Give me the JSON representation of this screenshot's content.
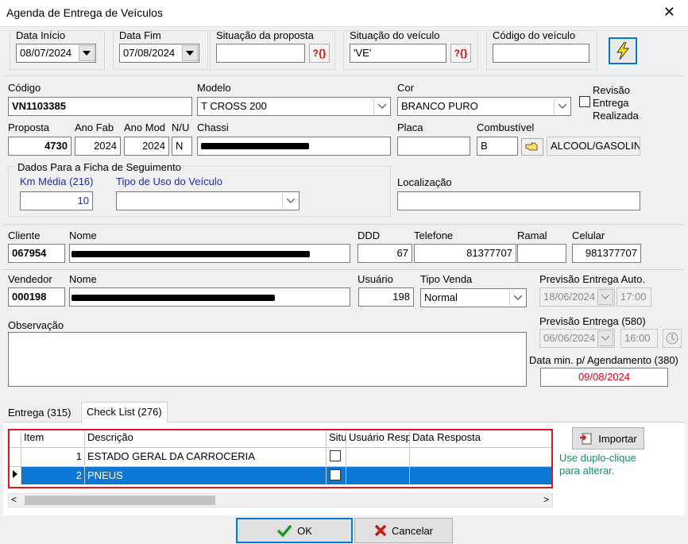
{
  "window": {
    "title": "Agenda de Entrega de Veículos",
    "close": "✕"
  },
  "filters": {
    "data_inicio_label": "Data Início",
    "data_inicio": "08/07/2024",
    "data_fim_label": "Data Fim",
    "data_fim": "07/08/2024",
    "situacao_proposta_label": "Situação da proposta",
    "situacao_proposta": "",
    "situacao_veiculo_label": "Situação do veículo",
    "situacao_veiculo": "'VE'",
    "codigo_veiculo_label": "Código do veículo",
    "codigo_veiculo": "",
    "query_button": "?{}"
  },
  "vehicle": {
    "codigo_label": "Código",
    "codigo": "VN1103385",
    "modelo_label": "Modelo",
    "modelo": "T CROSS 200",
    "cor_label": "Cor",
    "cor": "BRANCO PURO",
    "revisao_label": "Revisão Entrega Realizada",
    "revisao_line1": "Revisão",
    "revisao_line2": "Entrega",
    "revisao_line3": "Realizada",
    "proposta_label": "Proposta",
    "proposta": "4730",
    "ano_fab_label": "Ano Fab",
    "ano_fab": "2024",
    "ano_mod_label": "Ano Mod",
    "ano_mod": "2024",
    "nu_label": "N/U",
    "nu": "N",
    "chassi_label": "Chassi",
    "placa_label": "Placa",
    "placa": "",
    "combustivel_label": "Combustível",
    "combustivel_code": "B",
    "combustivel": "ALCOOL/GASOLINA"
  },
  "ficha": {
    "group_label": "Dados Para a Ficha de Seguimento",
    "km_media_label": "Km Média (216)",
    "km_media": "10",
    "tipo_uso_label": "Tipo de Uso do Veículo",
    "tipo_uso": "",
    "localizacao_label": "Localização",
    "localizacao": ""
  },
  "cliente": {
    "cliente_label": "Cliente",
    "cliente": "067954",
    "nome_label": "Nome",
    "ddd_label": "DDD",
    "ddd": "67",
    "telefone_label": "Telefone",
    "telefone": "81377707",
    "ramal_label": "Ramal",
    "ramal": "",
    "celular_label": "Celular",
    "celular": "981377707"
  },
  "vendedor": {
    "vendedor_label": "Vendedor",
    "vendedor": "000198",
    "nome_label": "Nome",
    "usuario_label": "Usuário",
    "usuario": "198",
    "tipo_venda_label": "Tipo Venda",
    "tipo_venda": "Normal",
    "prev_auto_label": "Previsão Entrega Auto.",
    "prev_auto_date": "18/06/2024",
    "prev_auto_time": "17:00"
  },
  "observacao": {
    "label": "Observação",
    "value": "",
    "prev_entrega_label": "Previsão Entrega (580)",
    "prev_entrega_date": "06/06/2024",
    "prev_entrega_time": "16:00",
    "data_min_label": "Data min. p/ Agendamento (380)",
    "data_min": "09/08/2024"
  },
  "tabs": [
    {
      "label": "Entrega (315)"
    },
    {
      "label": "Check List (276)"
    }
  ],
  "grid": {
    "columns": [
      "Item",
      "Descrição",
      "Situ",
      "Usuário Resp",
      "Data Resposta"
    ],
    "rows": [
      {
        "item": "1",
        "descricao": "ESTADO GERAL DA CARROCERIA"
      },
      {
        "item": "2",
        "descricao": "PNEUS"
      }
    ]
  },
  "importar_label": "Importar",
  "hint_line1": "Use duplo-clique",
  "hint_line2": "para alterar.",
  "footer": {
    "ok_label": "OK",
    "cancel_label": "Cancelar"
  },
  "colors": {
    "accent": "#0c78d6",
    "highlight_border": "#e1151e",
    "red_text": "#e0001b",
    "hint": "#1a8a6e",
    "label_blue": "#1e2ca8"
  }
}
